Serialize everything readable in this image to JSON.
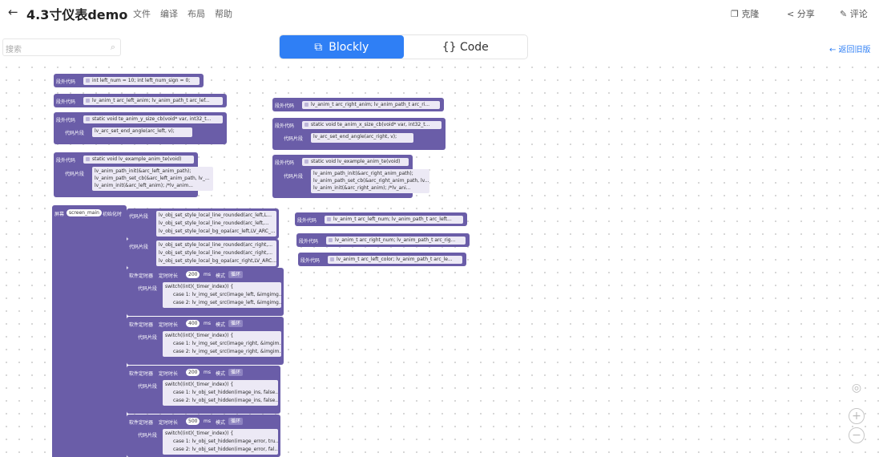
{
  "header": {
    "back_icon": "←",
    "title": "4.3寸仪表demo",
    "menu": [
      "文件",
      "编译",
      "布局",
      "帮助"
    ],
    "clone": "克隆",
    "share": "分享",
    "comment": "评论"
  },
  "toolbar": {
    "search_placeholder": "搜索",
    "tab_blockly": "Blockly",
    "tab_code": "{} Code",
    "back_old": "← 返回旧版"
  },
  "blocks": {
    "l1": {
      "label": "段外代码",
      "code": "int left_num = 10; int left_num_sign = 0;"
    },
    "l2": {
      "label": "段外代码",
      "code": "lv_anim_t arc_left_anim; lv_anim_path_t arc_lef..."
    },
    "l3": {
      "label": "段外代码",
      "code": "static void te_anim_y_size_cb(void* var, int32_t..."
    },
    "l3b": {
      "label": "代码片段",
      "code": "lv_arc_set_end_angle(arc_left, v);"
    },
    "l4": {
      "label": "段外代码",
      "code": "static void lv_example_anim_te(void)"
    },
    "l4b": {
      "label": "代码片段",
      "lines": [
        "lv_anim_path_init(&arc_left_anim_path);",
        "lv_anim_path_set_cb(&arc_left_anim_path, lv_...",
        "lv_anim_init(&arc_left_anim);      /*lv_anim..."
      ]
    },
    "r1": {
      "label": "段外代码",
      "code": "lv_anim_t arc_right_anim; lv_anim_path_t arc_ri..."
    },
    "r2": {
      "label": "段外代码",
      "code": "static void te_anim_x_size_cb(void* var, int32_t..."
    },
    "r2b": {
      "label": "代码片段",
      "code": "lv_arc_set_end_angle(arc_right, v);"
    },
    "r3": {
      "label": "段外代码",
      "code": "static void lv_example_anim_te(void)"
    },
    "r3b": {
      "label": "代码片段",
      "lines": [
        "lv_anim_path_init(&arc_right_anim_path);",
        "lv_anim_path_set_cb(&arc_right_anim_path, lv...",
        "lv_anim_init(&arc_right_anim);      /*lv_ani..."
      ]
    },
    "r4": {
      "label": "段外代码",
      "code": "lv_anim_t arc_left_num; lv_anim_path_t arc_left..."
    },
    "r5": {
      "label": "段外代码",
      "code": "lv_anim_t arc_right_num; lv_anim_path_t arc_rig..."
    },
    "r6": {
      "label": "段外代码",
      "code": "lv_anim_t arc_left_color; lv_anim_path_t arc_le..."
    },
    "screen": {
      "label": "屏幕",
      "name": "screen_main",
      "init": "初始化时"
    },
    "s1": {
      "label": "代码片段",
      "lines": [
        "lv_obj_set_style_local_line_rounded(arc_left,L...",
        "lv_obj_set_style_local_line_rounded(arc_left,...",
        "lv_obj_set_style_local_bg_opa(arc_left,LV_ARC_..."
      ]
    },
    "s2": {
      "label": "代码片段",
      "lines": [
        "lv_obj_set_style_local_line_rounded(arc_right,...",
        "lv_obj_set_style_local_line_rounded(arc_right,...",
        "lv_obj_set_style_local_bg_opa(arc_right,LV_ARC..."
      ]
    },
    "t1": {
      "label": "软件定时器",
      "dur": "定时时长",
      "val": "200",
      "ms": "ms",
      "mode": "模式",
      "loop": "循环",
      "sub": "代码片段",
      "lines": [
        "switch((int)(_timer_index)) {",
        "case 1: lv_img_set_src(image_left, &imgimg...",
        "case 2: lv_img_set_src(image_left, &imgimg..."
      ]
    },
    "t2": {
      "label": "软件定时器",
      "dur": "定时时长",
      "val": "400",
      "ms": "ms",
      "mode": "模式",
      "loop": "循环",
      "sub": "代码片段",
      "lines": [
        "switch((int)(_timer_index)) {",
        "case 1: lv_img_set_src(image_right, &imgim...",
        "case 2: lv_img_set_src(image_right, &imgim..."
      ]
    },
    "t3": {
      "label": "软件定时器",
      "dur": "定时时长",
      "val": "200",
      "ms": "ms",
      "mode": "模式",
      "loop": "循环",
      "sub": "代码片段",
      "lines": [
        "switch((int)(_timer_index)) {",
        "case 1: lv_obj_set_hidden(image_ins, false...",
        "case 2: lv_obj_set_hidden(image_ins, false..."
      ]
    },
    "t4": {
      "label": "软件定时器",
      "dur": "定时时长",
      "val": "500",
      "ms": "ms",
      "mode": "模式",
      "loop": "循环",
      "sub": "代码片段",
      "lines": [
        "switch((int)(_timer_index)) {",
        "case 1: lv_obj_set_hidden(image_error, tru...",
        "case 2: lv_obj_set_hidden(image_error, fal..."
      ]
    }
  },
  "colors": {
    "block": "#6a5da8",
    "field": "#ece9f5",
    "accent": "#2f7ff5"
  }
}
